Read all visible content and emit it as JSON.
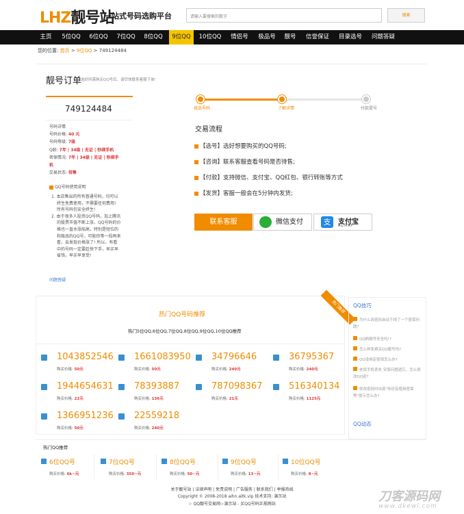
{
  "header": {
    "logo_latin": "LHZ",
    "logo_cjk": "靓号站",
    "slogan": "一站式号码选购平台",
    "search_placeholder": "请输入要搜索的数字",
    "search_button": "搜索"
  },
  "nav": [
    "主页",
    "5位QQ",
    "6位QQ",
    "7位QQ",
    "8位QQ",
    "9位QQ",
    "10位QQ",
    "情侣号",
    "极品号",
    "靓号",
    "信誉保证",
    "目录选号",
    "问题答疑"
  ],
  "nav_active": "9位QQ",
  "breadcrumb": {
    "prefix": "您的位置:",
    "home": "首页",
    "sep1": ">",
    "cat": "9位QQ",
    "sep2": ">",
    "current": "749124484"
  },
  "order": {
    "title": "靓号订单",
    "subtitle": "选好所需购买QQ号后，请尽快联系客服下单!",
    "number": "749124484",
    "details_header": "号码详情",
    "details": [
      {
        "label": "号码价格: ",
        "value": "40 元"
      },
      {
        "label": "号码等级: ",
        "value": "7级"
      },
      {
        "label": "Q龄: ",
        "value": "7年 | 34级 | 无证 | 秒绑手机"
      },
      {
        "label": "密保情况: ",
        "value": "7年 | 34级 | 无证 | 秒绑手"
      },
      {
        "label": "",
        "value": "机"
      },
      {
        "label": "交易状态: ",
        "value": "待售"
      }
    ],
    "notice_title": "QQ号码使用说明",
    "notice_lines": [
      "1. 本店售出的所有普通号码，均可以",
      "终生免费使用，不需要任何费用!",
      "所有号码包安全终生!",
      "2. 由于很多人投资QQ号码，加上腾讯",
      "的股票市值不断上涨，QQ号码的价",
      "格也一直水涨船高，特别是短位的",
      "和极品的QQ号，可能你等一段再来",
      "看，会发现价格涨了! 所以，有看",
      "中的号码一定要趁快下手，早买早",
      "省钱，早买早享受!"
    ],
    "faq_link": "问题答疑"
  },
  "steps": [
    "挑选号码",
    "了解详情",
    "付款提号"
  ],
  "flow": {
    "title": "交易流程",
    "items": [
      "【选号】选好想要购买的QQ号码;",
      "【咨询】联系客服查看号码是否待售;",
      "【付款】支持微信、支付宝、QQ红包、银行转账等方式",
      "【发货】客服一般会在5分钟内发货;"
    ],
    "btn_service": "联系客服",
    "btn_wechat": "微信支付",
    "btn_alipay": "支付宝",
    "btn_alipay_sub": "ALIPAY"
  },
  "hot": {
    "title": "热门QQ号码推荐",
    "subtitle": "热门5位QQ,6位QQ,7位QQ,8位QQ,9位QQ,10位QQ推荐",
    "ribbon": "热门推荐",
    "price_label": "购买价格: ",
    "items": [
      {
        "num": "1043852546",
        "price": "50元"
      },
      {
        "num": "1661083950",
        "price": "50元"
      },
      {
        "num": "34796646",
        "price": "240元"
      },
      {
        "num": "36795367",
        "price": "240元"
      },
      {
        "num": "1944654631",
        "price": "22元"
      },
      {
        "num": "78393887",
        "price": "136元"
      },
      {
        "num": "787098367",
        "price": "21元"
      },
      {
        "num": "516340134",
        "price": "1125元"
      },
      {
        "num": "1366951236",
        "price": "50元"
      },
      {
        "num": "22559218",
        "price": "240元"
      }
    ]
  },
  "qq_panel": {
    "title": "QQ技巧",
    "items": [
      "为什么改密码自动下线了一个密保问题?",
      "QQ刷靓号安全吗!?",
      "怎么样免费买QQ靓号吗?",
      "QQ没绑定密保怎么办?",
      "老保手机丢失 安保问题遗忘，怎么修改QQ密?",
      "修改密码时出现\"你还有使用密保等\"提示怎么办?"
    ],
    "dynamic_title": "QQ动态"
  },
  "section2": {
    "title": "热门QQ推荐",
    "items": [
      {
        "name": "6位QQ号",
        "price": "6k~元"
      },
      {
        "name": "7位QQ号",
        "price": "350~元"
      },
      {
        "name": "8位QQ号",
        "price": "50~元"
      },
      {
        "name": "9位QQ号",
        "price": "13~元"
      },
      {
        "name": "10位QQ号",
        "price": "8~元"
      }
    ]
  },
  "footer": {
    "links": "关于靓号站 | 法律声明 | 免责说明 | 广告服务 | 联系我们 | 举报热线",
    "copyright": "Copyright © 2008-2018 aihn.aitk.vip 技术支持: 演示站",
    "tagline": "☆ QQ靓号交易网☆演示站 - 买QQ号码正规网站"
  },
  "watermark": {
    "main": "刀客源码网",
    "url": "www.dkewl.com"
  }
}
